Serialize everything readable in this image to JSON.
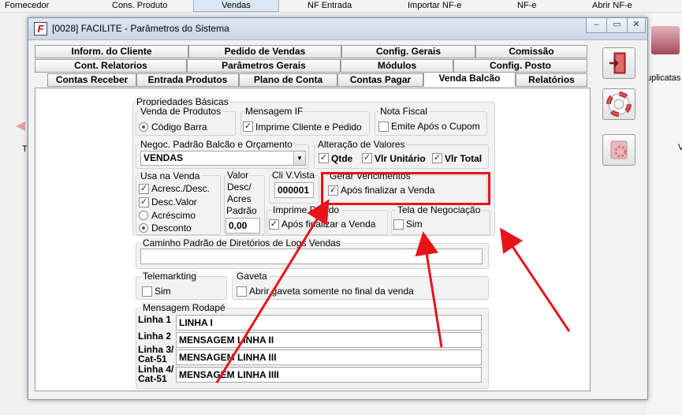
{
  "topbar": {
    "items": [
      "Fornecedor",
      "Cons. Produto",
      "Vendas",
      "NF Entrada",
      "Importar NF-e",
      "NF-e",
      "Abrir NF-e"
    ]
  },
  "background": {
    "right_label": "uplicatas",
    "left_label": "T",
    "right_letter": "V"
  },
  "window": {
    "title": "[0028] FACILITE - Parâmetros do Sistema",
    "icon_letter": "F",
    "minimize": "–",
    "restore": "▭",
    "close": "✕"
  },
  "tabs": {
    "row1": [
      "Inform. do Cliente",
      "Pedido de Vendas",
      "Config. Gerais",
      "Comissão"
    ],
    "row2": [
      "Cont. Relatorios",
      "Parâmetros Gerais",
      "Módulos",
      "Config. Posto"
    ],
    "row3": [
      "Contas Receber",
      "Entrada Produtos",
      "Plano de Conta",
      "Contas Pagar",
      "Venda Balcão",
      "Relatórios"
    ],
    "selected": "Venda Balcão"
  },
  "form": {
    "propriedades_label": "Propriedades Básicas",
    "venda_produtos": {
      "label": "Venda de Produtos",
      "option": "Código Barra",
      "selected": true
    },
    "mensagem_if": {
      "label": "Mensagem IF",
      "option": "Imprime Cliente e Pedido",
      "checked": true
    },
    "nota_fiscal": {
      "label": "Nota Fiscal",
      "option": "Emite Após o Cupom",
      "checked": false
    },
    "negoc": {
      "label": "Negoc. Padrão Balcão e Orçamento",
      "value": "VENDAS",
      "arrow": "▼"
    },
    "alteracao": {
      "label": "Alteração de Valores",
      "qtde": "Qtde",
      "vlr_unitario": "Vlr Unitário",
      "vlr_total": "Vlr Total"
    },
    "usa_venda": {
      "label": "Usa na Venda",
      "acresc_desc": "Acresc./Desc.",
      "desc_valor": "Desc.Valor",
      "acrescimo": "Acréscimo",
      "desconto": "Desconto"
    },
    "valor_desc": {
      "line1": "Valor",
      "line2": "Desc/",
      "line3": "Acres",
      "line4": "Padrão",
      "value": "0,00"
    },
    "cli_vista": {
      "label": "Cli V.Vista",
      "value": "000001"
    },
    "gerar_vencimentos": {
      "label": "Gerar Vencimentos",
      "option": "Após finalizar a Venda",
      "checked": true
    },
    "imprime_pedido": {
      "label": "Imprime Pedido",
      "option": "Após finalizar a Venda",
      "checked": true
    },
    "tela_negociacao": {
      "label": "Tela de Negociação",
      "option": "Sim",
      "checked": false
    },
    "caminho_logs": {
      "label": "Caminho Padrão de Diretórios de Logs Vendas",
      "value": ""
    },
    "telemarkting": {
      "label": "Telemarkting",
      "option": "Sim",
      "checked": false
    },
    "gaveta": {
      "label": "Gaveta",
      "option": "Abrir gaveta somente no final da venda",
      "checked": false
    },
    "rodape": {
      "label": "Mensagem Rodapé",
      "lines": [
        {
          "label": "Linha 1",
          "value": "LINHA I"
        },
        {
          "label": "Linha 2",
          "value": "MENSAGEM LINHA II"
        },
        {
          "label": "Linha 3/ Cat-51",
          "value": "MENSAGEM LINHA III"
        },
        {
          "label": "Linha 4/ Cat-51",
          "value": "MENSAGEM LINHA IIII"
        }
      ]
    }
  },
  "check_mark": "✓",
  "colors": {
    "annotation": "#e8141b",
    "titlebar": "#d6e1ee"
  }
}
